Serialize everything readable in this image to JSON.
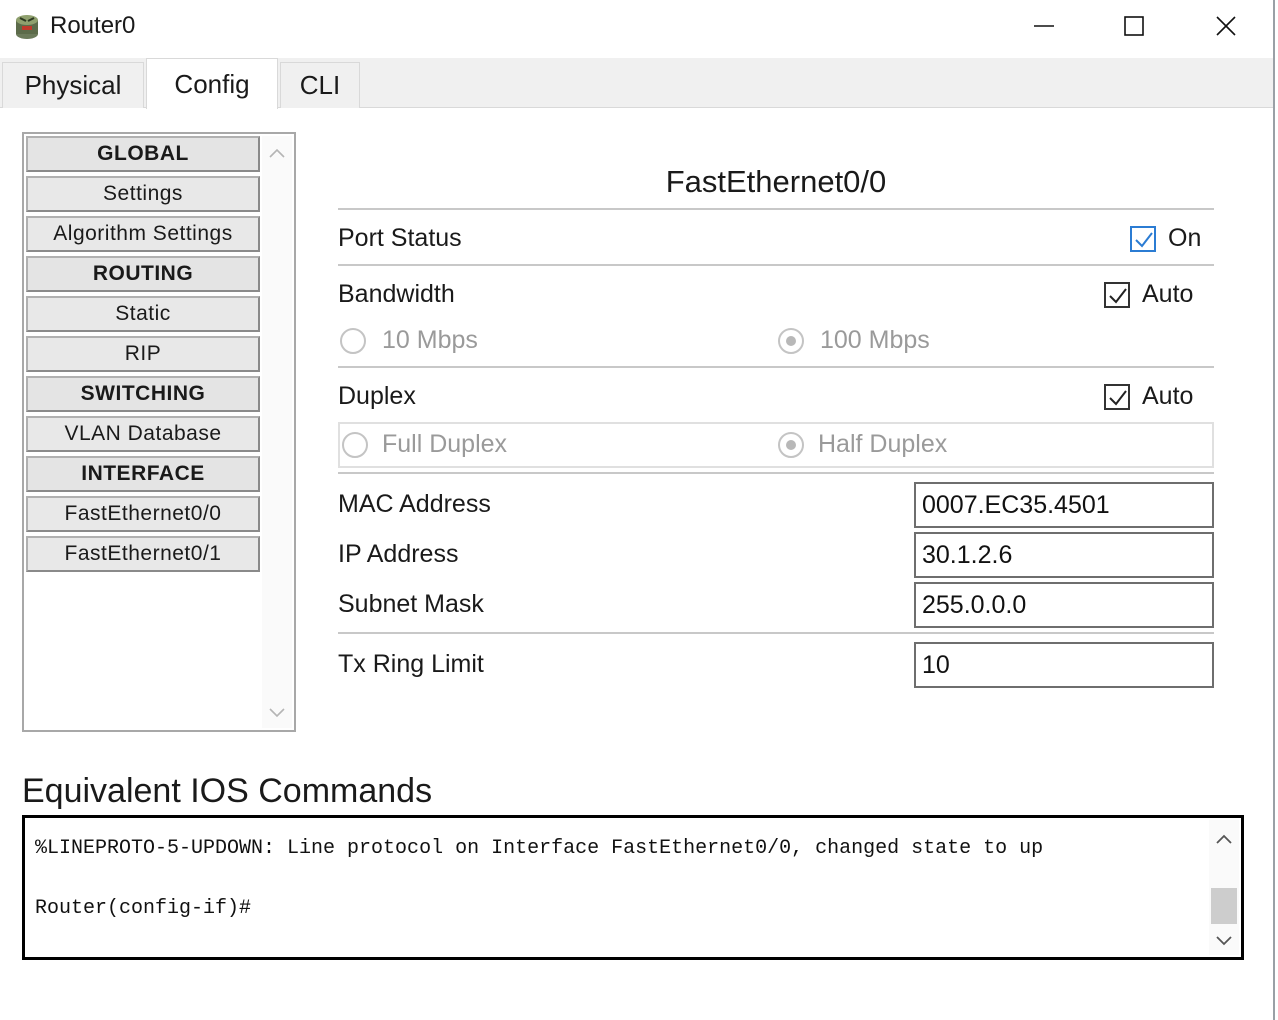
{
  "window": {
    "title": "Router0"
  },
  "tabs": [
    {
      "label": "Physical"
    },
    {
      "label": "Config"
    },
    {
      "label": "CLI"
    }
  ],
  "nav": {
    "items": [
      {
        "label": "GLOBAL",
        "kind": "header"
      },
      {
        "label": "Settings",
        "kind": "item"
      },
      {
        "label": "Algorithm Settings",
        "kind": "item"
      },
      {
        "label": "ROUTING",
        "kind": "header"
      },
      {
        "label": "Static",
        "kind": "item"
      },
      {
        "label": "RIP",
        "kind": "item"
      },
      {
        "label": "SWITCHING",
        "kind": "header"
      },
      {
        "label": "VLAN Database",
        "kind": "item"
      },
      {
        "label": "INTERFACE",
        "kind": "header"
      },
      {
        "label": "FastEthernet0/0",
        "kind": "item"
      },
      {
        "label": "FastEthernet0/1",
        "kind": "item"
      }
    ]
  },
  "interface": {
    "title": "FastEthernet0/0",
    "port_status": {
      "label": "Port Status",
      "checkbox_label": "On",
      "checked": true
    },
    "bandwidth": {
      "label": "Bandwidth",
      "auto_label": "Auto",
      "auto_checked": true,
      "options": [
        "10 Mbps",
        "100 Mbps"
      ],
      "selected": "100 Mbps"
    },
    "duplex": {
      "label": "Duplex",
      "auto_label": "Auto",
      "auto_checked": true,
      "options": [
        "Full Duplex",
        "Half Duplex"
      ],
      "selected": "Half Duplex"
    },
    "mac": {
      "label": "MAC Address",
      "value": "0007.EC35.4501"
    },
    "ip": {
      "label": "IP Address",
      "value": "30.1.2.6"
    },
    "subnet": {
      "label": "Subnet Mask",
      "value": "255.0.0.0"
    },
    "tx_ring": {
      "label": "Tx Ring Limit",
      "value": "10"
    }
  },
  "ios": {
    "title": "Equivalent IOS Commands",
    "lines": "%LINEPROTO-5-UPDOWN: Line protocol on Interface FastEthernet0/0, changed state to up\n\nRouter(config-if)#"
  },
  "colors": {
    "accent_checkbox": "#2b7cd3",
    "tab_active_bg": "#ffffff",
    "tab_bg": "#f0f0f0"
  },
  "icons": [
    "router-app-icon",
    "minimize-icon",
    "maximize-icon",
    "close-icon",
    "scroll-up-icon",
    "scroll-down-icon",
    "checkmark-icon"
  ]
}
